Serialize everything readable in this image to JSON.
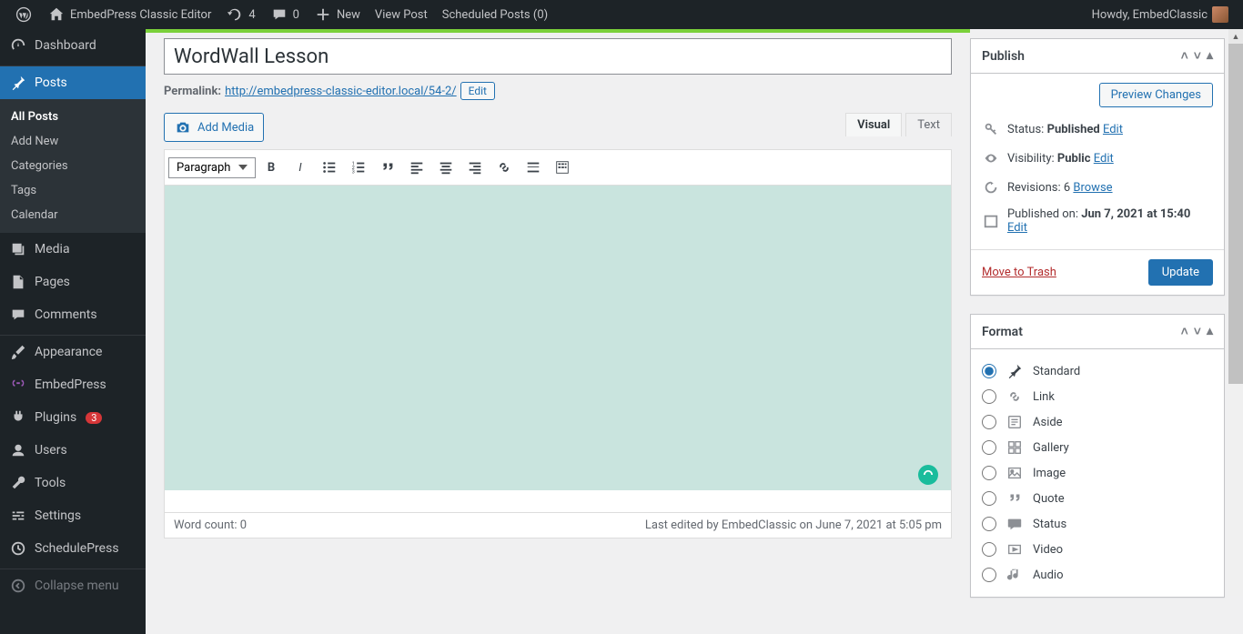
{
  "adminbar": {
    "site_name": "EmbedPress Classic Editor",
    "updates": "4",
    "comments": "0",
    "new": "New",
    "view_post": "View Post",
    "scheduled": "Scheduled Posts (0)",
    "howdy": "Howdy, EmbedClassic"
  },
  "sidebar": {
    "dashboard": "Dashboard",
    "posts": "Posts",
    "sub": {
      "all": "All Posts",
      "add": "Add New",
      "cats": "Categories",
      "tags": "Tags",
      "calendar": "Calendar"
    },
    "media": "Media",
    "pages": "Pages",
    "comments": "Comments",
    "appearance": "Appearance",
    "embedpress": "EmbedPress",
    "plugins": "Plugins",
    "plugins_badge": "3",
    "users": "Users",
    "tools": "Tools",
    "settings": "Settings",
    "schedulepress": "SchedulePress",
    "collapse": "Collapse menu"
  },
  "editor": {
    "title": "WordWall Lesson",
    "permalink_label": "Permalink:",
    "permalink_url": "http://embedpress-classic-editor.local/54-2/",
    "permalink_edit": "Edit",
    "add_media": "Add Media",
    "tab_visual": "Visual",
    "tab_text": "Text",
    "format_select": "Paragraph",
    "word_count": "Word count: 0",
    "last_edited": "Last edited by EmbedClassic on June 7, 2021 at 5:05 pm"
  },
  "publish": {
    "title": "Publish",
    "preview": "Preview Changes",
    "status_label": "Status:",
    "status_val": "Published",
    "visibility_label": "Visibility:",
    "visibility_val": "Public",
    "revisions_label": "Revisions:",
    "revisions_val": "6",
    "browse": "Browse",
    "published_label": "Published on:",
    "published_val": "Jun 7, 2021 at 15:40",
    "edit": "Edit",
    "trash": "Move to Trash",
    "update": "Update"
  },
  "format": {
    "title": "Format",
    "items": {
      "standard": "Standard",
      "link": "Link",
      "aside": "Aside",
      "gallery": "Gallery",
      "image": "Image",
      "quote": "Quote",
      "status": "Status",
      "video": "Video",
      "audio": "Audio"
    }
  }
}
